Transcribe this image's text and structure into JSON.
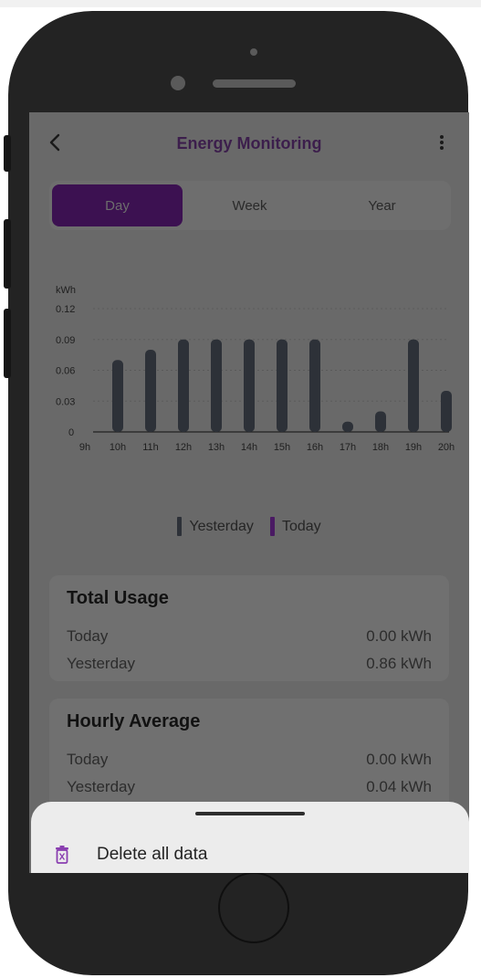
{
  "header": {
    "title": "Energy Monitoring"
  },
  "tabs": [
    {
      "label": "Day",
      "active": true
    },
    {
      "label": "Week",
      "active": false
    },
    {
      "label": "Year",
      "active": false
    }
  ],
  "chart_data": {
    "type": "bar",
    "ylabel": "kWh",
    "ylim": [
      0,
      0.12
    ],
    "yticks": [
      "0",
      "0.03",
      "0.06",
      "0.09",
      "0.12"
    ],
    "categories": [
      "9h",
      "10h",
      "11h",
      "12h",
      "13h",
      "14h",
      "15h",
      "16h",
      "17h",
      "18h",
      "19h",
      "20h"
    ],
    "series": [
      {
        "name": "Yesterday",
        "values": [
          0,
          0.07,
          0.08,
          0.09,
          0.09,
          0.09,
          0.09,
          0.09,
          0.01,
          0.02,
          0.09,
          0.04
        ]
      },
      {
        "name": "Today",
        "values": [
          0,
          0,
          0,
          0,
          0,
          0,
          0,
          0,
          0,
          0,
          0,
          0
        ]
      }
    ],
    "grid": true,
    "legend": "bottom-center"
  },
  "legend": {
    "yesterday": "Yesterday",
    "today": "Today"
  },
  "total_usage": {
    "title": "Total Usage",
    "rows": [
      {
        "label": "Today",
        "value": "0.00 kWh"
      },
      {
        "label": "Yesterday",
        "value": "0.86 kWh"
      }
    ]
  },
  "hourly_average": {
    "title": "Hourly Average",
    "rows": [
      {
        "label": "Today",
        "value": "0.00 kWh"
      },
      {
        "label": "Yesterday",
        "value": "0.04 kWh"
      }
    ]
  },
  "sheet": {
    "delete_label": "Delete all data"
  },
  "colors": {
    "yesterday": "#2d3138",
    "today": "#4a1a63",
    "accent": "#5b1f7a",
    "overlay": "#696969"
  },
  "icons": {
    "back": "chevron-left-icon",
    "menu": "more-vertical-icon",
    "delete": "trash-icon"
  }
}
